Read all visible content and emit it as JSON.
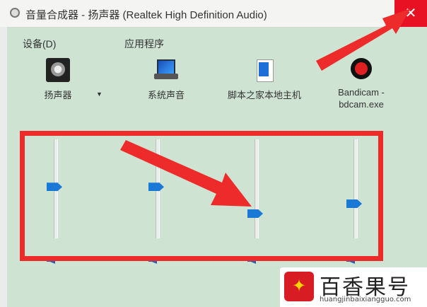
{
  "window": {
    "title": "音量合成器 - 扬声器 (Realtek High Definition Audio)",
    "close_glyph": "✕"
  },
  "devices_section": {
    "label": "设备(D)",
    "device": {
      "name": "扬声器",
      "icon": "speaker-icon",
      "dropdown_glyph": "▼"
    }
  },
  "apps_section": {
    "label": "应用程序",
    "apps": [
      {
        "name": "系统声音",
        "icon": "system-sounds-icon"
      },
      {
        "name": "脚本之家本地主机",
        "icon": "script-host-icon"
      },
      {
        "name": "Bandicam - bdcam.exe",
        "icon": "bandicam-icon"
      }
    ]
  },
  "sliders": [
    {
      "name": "speaker",
      "level": 0.52
    },
    {
      "name": "system-sounds",
      "level": 0.52
    },
    {
      "name": "script-host",
      "level": 0.25
    },
    {
      "name": "bandicam",
      "level": 0.35
    }
  ],
  "watermark": {
    "brand": "百香果号",
    "url": "huangjinbaixiangguo.com",
    "logo_glyph": "✦"
  },
  "colors": {
    "highlight_red": "#ee2b2b",
    "accent_blue": "#1a78d6",
    "close_red": "#e81123"
  }
}
